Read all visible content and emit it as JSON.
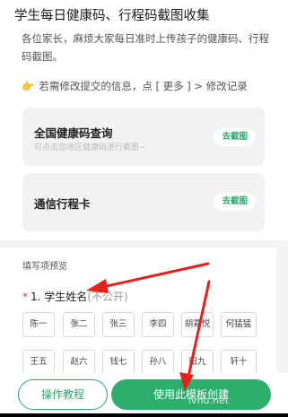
{
  "header": {
    "title": "学生每日健康码、行程码截图收集",
    "description": "各位家长，麻烦大家每日准时上传孩子的健康码、行程码截图。",
    "hint_icon": "pointing-hand-icon",
    "hint_text": "若需修改提交的信息，点 [ 更多 ] > 修改记录"
  },
  "cards": [
    {
      "title": "全国健康码查询",
      "subtitle": "可点击您地区健康码进行截图~",
      "button": "去截图"
    },
    {
      "title": "通信行程卡",
      "button": "去截图"
    }
  ],
  "form": {
    "section_label": "填写项预览",
    "question": {
      "required_mark": "*",
      "label": "1. 学生姓名",
      "privacy": "(不公开)"
    },
    "options": [
      "陈一",
      "张二",
      "张三",
      "李四",
      "胡嘉悦",
      "何猛猛",
      "王五",
      "赵六",
      "钱七",
      "孙八",
      "田九",
      "轩十"
    ]
  },
  "footer": {
    "tutorial_button": "操作教程",
    "use_button": "使用此模板创建",
    "watermark": "lvhu.net"
  },
  "colors": {
    "accent": "#2eae6c",
    "required": "#e03b3b",
    "annotation_arrow": "#e8201c"
  }
}
